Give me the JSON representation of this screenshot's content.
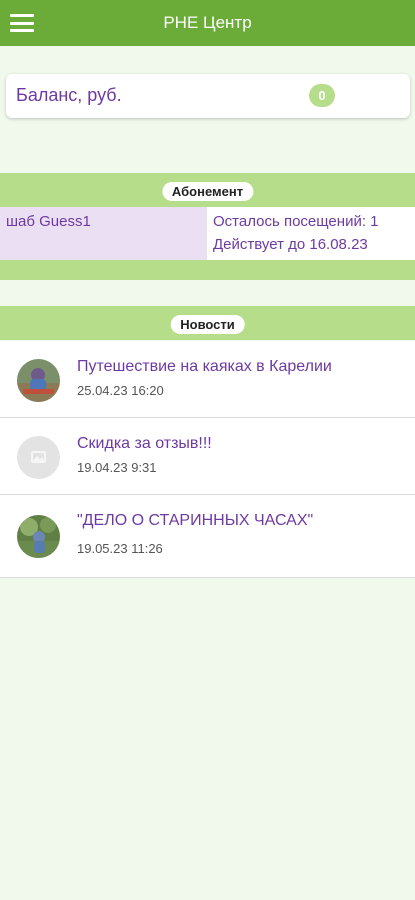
{
  "app": {
    "title": "PHE Центр",
    "brand_color": "#6aac37",
    "accent_color": "#b5dd8a",
    "text_color": "#6e3aa1"
  },
  "header": {
    "menu_icon": "hamburger-menu-icon"
  },
  "balance": {
    "label": "Баланс, руб.",
    "value": "0"
  },
  "subscription": {
    "section_title": "Абонемент",
    "items": [
      {
        "name": "шаб Guess1",
        "visits_left": "Осталось посещений: 1",
        "valid_until": "Действует до 16.08.23"
      }
    ]
  },
  "news": {
    "section_title": "Новости",
    "items": [
      {
        "title": "Путешествие на каяках в Карелии",
        "date": "25.04.23 16:20",
        "avatar_icon": "kayak-trip-photo"
      },
      {
        "title": "Скидка за отзыв!!!",
        "date": "19.04.23 9:31",
        "avatar_icon": "placeholder-image-icon"
      },
      {
        "title": "\"ДЕЛО О СТАРИННЫХ ЧАСАХ\"",
        "date": "19.05.23 11:26",
        "avatar_icon": "event-photo"
      }
    ]
  }
}
